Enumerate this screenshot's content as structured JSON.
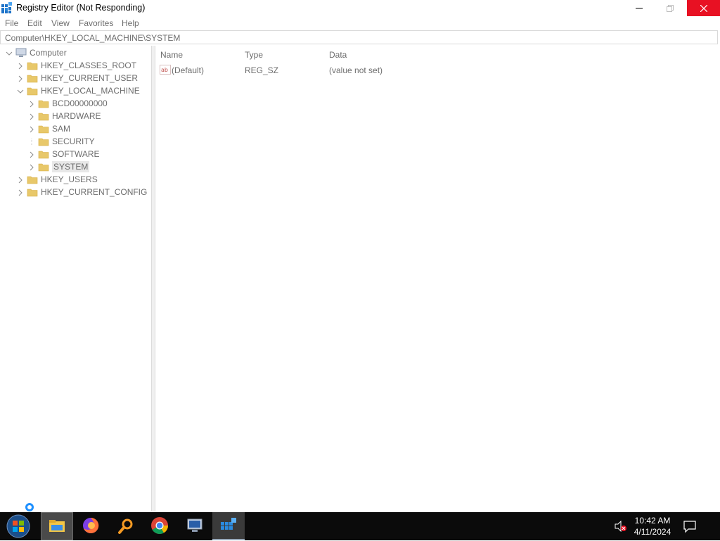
{
  "window": {
    "title": "Registry Editor (Not Responding)"
  },
  "menu": [
    "File",
    "Edit",
    "View",
    "Favorites",
    "Help"
  ],
  "address": "Computer\\HKEY_LOCAL_MACHINE\\SYSTEM",
  "tree": {
    "root": "Computer",
    "hives": {
      "classes_root": "HKEY_CLASSES_ROOT",
      "current_user": "HKEY_CURRENT_USER",
      "local_machine": "HKEY_LOCAL_MACHINE",
      "users": "HKEY_USERS",
      "current_config": "HKEY_CURRENT_CONFIG"
    },
    "local_machine_children": [
      "BCD00000000",
      "HARDWARE",
      "SAM",
      "SECURITY",
      "SOFTWARE",
      "SYSTEM"
    ],
    "selected": "SYSTEM"
  },
  "list": {
    "columns": [
      "Name",
      "Type",
      "Data"
    ],
    "rows": [
      {
        "name": "(Default)",
        "type": "REG_SZ",
        "data": "(value not set)"
      }
    ]
  },
  "taskbar": {
    "time": "10:42 AM",
    "date": "4/11/2024"
  },
  "colors": {
    "close_button": "#e81123",
    "taskbar": "#0b0b0b",
    "folder": "#e8c86a"
  }
}
